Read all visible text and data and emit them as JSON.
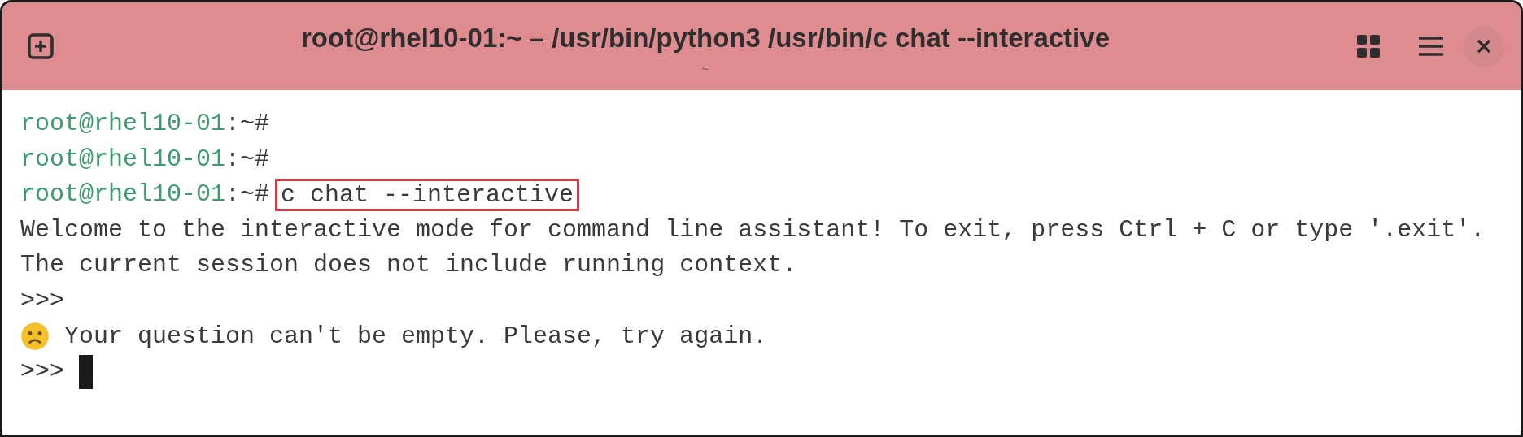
{
  "window": {
    "title": "root@rhel10-01:~ – /usr/bin/python3 /usr/bin/c chat --interactive",
    "subtitle": "~"
  },
  "terminal": {
    "lines": [
      {
        "kind": "prompt",
        "user_host": "root@rhel10-01",
        "path": ":~#"
      },
      {
        "kind": "prompt",
        "user_host": "root@rhel10-01",
        "path": ":~#"
      },
      {
        "kind": "prompt",
        "user_host": "root@rhel10-01",
        "path": ":~#",
        "command": "c chat --interactive",
        "highlighted": true
      },
      {
        "kind": "output",
        "text": "Welcome to the interactive mode for command line assistant! To exit, press Ctrl + C or type '.exit'."
      },
      {
        "kind": "output",
        "text": "The current session does not include running context."
      },
      {
        "kind": "input",
        "prompt": ">>>",
        "cursor": false
      },
      {
        "kind": "error",
        "text": "Your question can't be empty. Please, try again."
      },
      {
        "kind": "input",
        "prompt": ">>>",
        "cursor": true
      }
    ]
  }
}
